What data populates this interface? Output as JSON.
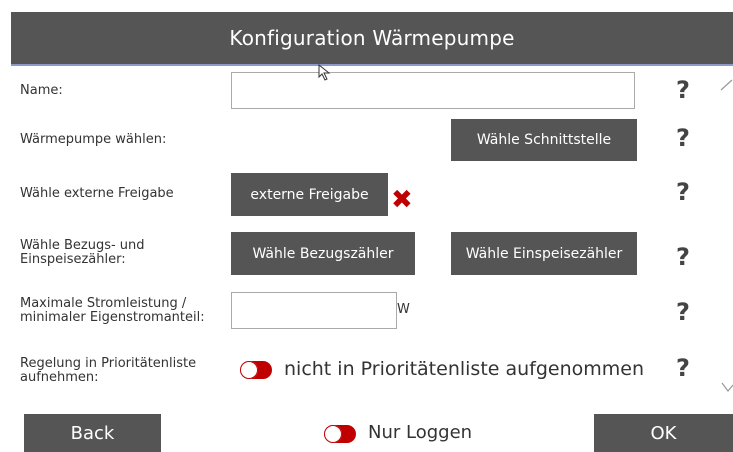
{
  "header": {
    "title": "Konfiguration Wärmepumpe"
  },
  "form": {
    "name": {
      "label": "Name:",
      "value": "",
      "placeholder": ""
    },
    "heatpump": {
      "label": "Wärmepumpe wählen:",
      "button": "Wähle Schnittstelle"
    },
    "release": {
      "label": "Wähle externe Freigabe",
      "button": "externe Freigabe",
      "remove_icon": "close-icon",
      "remove_color": "#c00000"
    },
    "meters": {
      "label_line1": "Wähle Bezugs- und",
      "label_line2": "Einspeisezähler:",
      "button_consumption": "Wähle Bezugszähler",
      "button_feedin": "Wähle Einspeisezähler"
    },
    "power": {
      "label_line1": "Maximale Stromleistung /",
      "label_line2": "minimaler Eigenstromanteil:",
      "value": "",
      "unit": "W"
    },
    "priority": {
      "label_line1": "Regelung in Prioritätenliste",
      "label_line2": "aufnehmen:",
      "toggle_text": "nicht in Prioritätenliste aufgenommen",
      "toggle_on": false
    }
  },
  "help_label": "?",
  "footer": {
    "back": "Back",
    "log_only": "Nur Loggen",
    "log_only_on": false,
    "ok": "OK"
  },
  "colors": {
    "button_bg": "#555555",
    "toggle_off": "#c00000",
    "title_bg": "#555555",
    "title_underline": "#8d99c8"
  }
}
